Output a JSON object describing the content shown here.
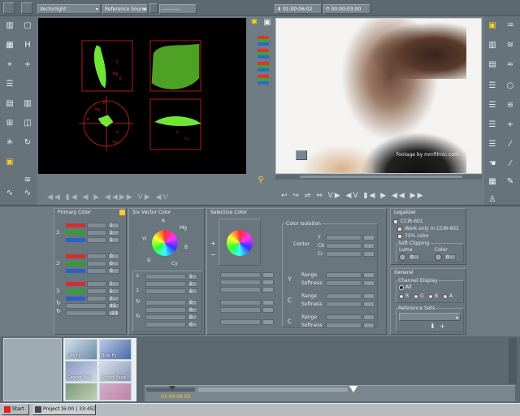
{
  "toolbar": {
    "scope_mode": "Vectorlight",
    "reference_source": "Reference Source",
    "ref_timecode": "--:--:--:--",
    "timecode_current": "01:00:06:02",
    "timecode_duration": "00:00:03:00"
  },
  "preview": {
    "watermark": "footage by mmfilmic.com"
  },
  "primary_color": {
    "title": "Primary Color",
    "values": [
      "1",
      "1",
      "1",
      "0",
      "0",
      "0",
      "1",
      "1",
      "1",
      "45",
      "-23"
    ]
  },
  "six_vector_color": {
    "title": "Six Vector Color",
    "wheel_labels": [
      "R",
      "Mg",
      "B",
      "Cy",
      "G",
      "Yl"
    ],
    "values": [
      "1",
      "1",
      "1",
      "0",
      "0",
      "0",
      "0",
      "0"
    ]
  },
  "selective_color": {
    "title": "Selective Color",
    "color_isolation": "Color Isolation",
    "center": "Center",
    "channels": [
      "Y",
      "Cb",
      "Cr"
    ],
    "range": "Range",
    "softness": "Softness"
  },
  "legalizer": {
    "title": "Legalizer",
    "ccir601": "CCIR-601",
    "work_only": "Work only in CCIR-601",
    "color_75": "75% color",
    "soft_clipping": "Soft Clipping",
    "luma": "Luma",
    "color": "Color",
    "luma_value": "0",
    "color_value": "0"
  },
  "general": {
    "title": "General",
    "channel_display": "Channel Display",
    "channels": [
      "All",
      "R",
      "G",
      "B",
      "A"
    ],
    "reference_sets": "Reference Sets"
  },
  "bins": {
    "thumbs": [
      "Lite Fx",
      "Blue Fx",
      "Cooper Bell",
      "School Fade",
      "",
      ""
    ]
  },
  "timeline": {
    "timecode": "01:00:06:02"
  },
  "taskbar": {
    "start": "Start",
    "task": "Project [6:00 | 33:45]"
  },
  "colors": {
    "scope_trace": "#7dff3a",
    "scope_graticule": "#e02020",
    "accent": "#ffcc22"
  }
}
